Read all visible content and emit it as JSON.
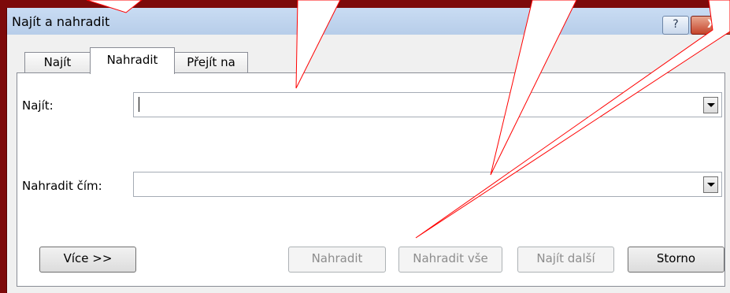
{
  "window": {
    "title": "Najít a nahradit",
    "help_label": "?",
    "close_label": "X"
  },
  "tabs": [
    {
      "label": "Najít",
      "active": false
    },
    {
      "label": "Nahradit",
      "active": true
    },
    {
      "label": "Přejít na",
      "active": false
    }
  ],
  "find": {
    "label": "Najít:",
    "value": ""
  },
  "replace": {
    "label": "Nahradit čím:",
    "value": ""
  },
  "buttons": {
    "more": "Více >>",
    "replace": "Nahradit",
    "replace_all": "Nahradit vše",
    "find_next": "Najít další",
    "cancel": "Storno"
  },
  "colors": {
    "background": "#7d0a0a",
    "callout_stroke": "#ff0000"
  }
}
